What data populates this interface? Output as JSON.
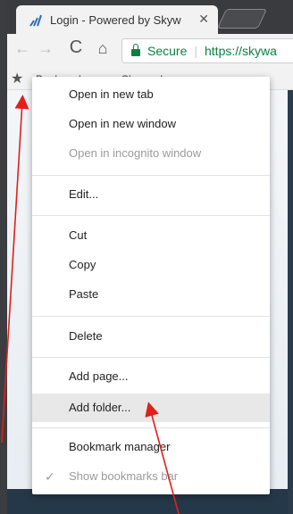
{
  "tab": {
    "title": "Login - Powered by Skyw",
    "close_glyph": "✕"
  },
  "toolbar": {
    "back_glyph": "←",
    "forward_glyph": "→",
    "reload_glyph": "C",
    "home_glyph": "⌂",
    "secure_label": "Secure",
    "separator": "|",
    "url": "https://skywa"
  },
  "bookmarks_bar": {
    "apps_glyph": "★",
    "label": "Bookmarks",
    "item": "Skyward"
  },
  "context_menu": {
    "items": [
      {
        "label": "Open in new tab",
        "enabled": true
      },
      {
        "label": "Open in new window",
        "enabled": true
      },
      {
        "label": "Open in incognito window",
        "enabled": false
      },
      {
        "label": "Edit...",
        "enabled": true
      },
      {
        "label": "Cut",
        "enabled": true
      },
      {
        "label": "Copy",
        "enabled": true
      },
      {
        "label": "Paste",
        "enabled": true
      },
      {
        "label": "Delete",
        "enabled": true
      },
      {
        "label": "Add page...",
        "enabled": true
      },
      {
        "label": "Add folder...",
        "enabled": true,
        "highlighted": true
      },
      {
        "label": "Bookmark manager",
        "enabled": true
      },
      {
        "label": "Show bookmarks bar",
        "enabled": false,
        "checked": true
      }
    ],
    "check_glyph": "✓"
  },
  "colors": {
    "secure_green": "#0b8043",
    "annotation_red": "#e0201c",
    "menu_highlight": "#e8e8e8",
    "disabled_text": "#9a9a9a"
  }
}
